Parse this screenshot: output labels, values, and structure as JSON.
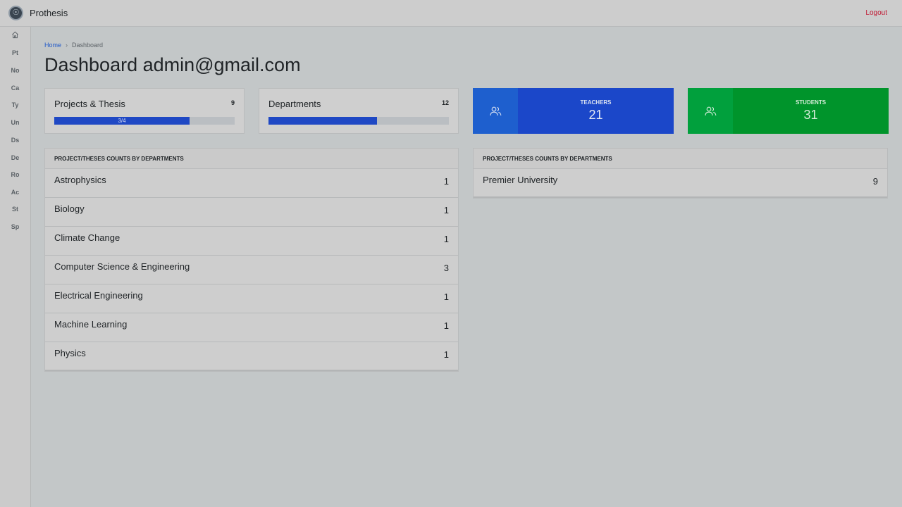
{
  "app": {
    "name": "Prothesis",
    "logout_label": "Logout"
  },
  "sidebar": {
    "items": [
      {
        "label": "",
        "icon": "home-icon"
      },
      {
        "label": "Pt"
      },
      {
        "label": "No"
      },
      {
        "label": "Ca"
      },
      {
        "label": "Ty"
      },
      {
        "label": "Un"
      },
      {
        "label": "Ds"
      },
      {
        "label": "De"
      },
      {
        "label": "Ro"
      },
      {
        "label": "Ac"
      },
      {
        "label": "St"
      },
      {
        "label": "Sp"
      }
    ]
  },
  "breadcrumb": {
    "home": "Home",
    "separator": "›",
    "current": "Dashboard"
  },
  "page_title": "Dashboard admin@gmail.com",
  "stats": {
    "projects": {
      "title": "Projects & Thesis",
      "count": "9",
      "progress_label": "3/4",
      "progress_fraction": 0.75
    },
    "departments": {
      "title": "Departments",
      "count": "12",
      "progress_fraction": 0.6
    },
    "teachers": {
      "label": "TEACHERS",
      "value": "21",
      "icon": "users-icon",
      "color": "#1b47c9"
    },
    "students": {
      "label": "STUDENTS",
      "value": "31",
      "icon": "users-icon",
      "color": "#00942b"
    }
  },
  "panels": {
    "left": {
      "header": "PROJECT/THESES COUNTS BY DEPARTMENTS",
      "rows": [
        {
          "name": "Astrophysics",
          "count": "1"
        },
        {
          "name": "Biology",
          "count": "1"
        },
        {
          "name": "Climate Change",
          "count": "1"
        },
        {
          "name": "Computer Science & Engineering",
          "count": "3"
        },
        {
          "name": "Electrical Engineering",
          "count": "1"
        },
        {
          "name": "Machine Learning",
          "count": "1"
        },
        {
          "name": "Physics",
          "count": "1"
        }
      ]
    },
    "right": {
      "header": "PROJECT/THESES COUNTS BY DEPARTMENTS",
      "rows": [
        {
          "name": "Premier University",
          "count": "9"
        }
      ]
    }
  }
}
